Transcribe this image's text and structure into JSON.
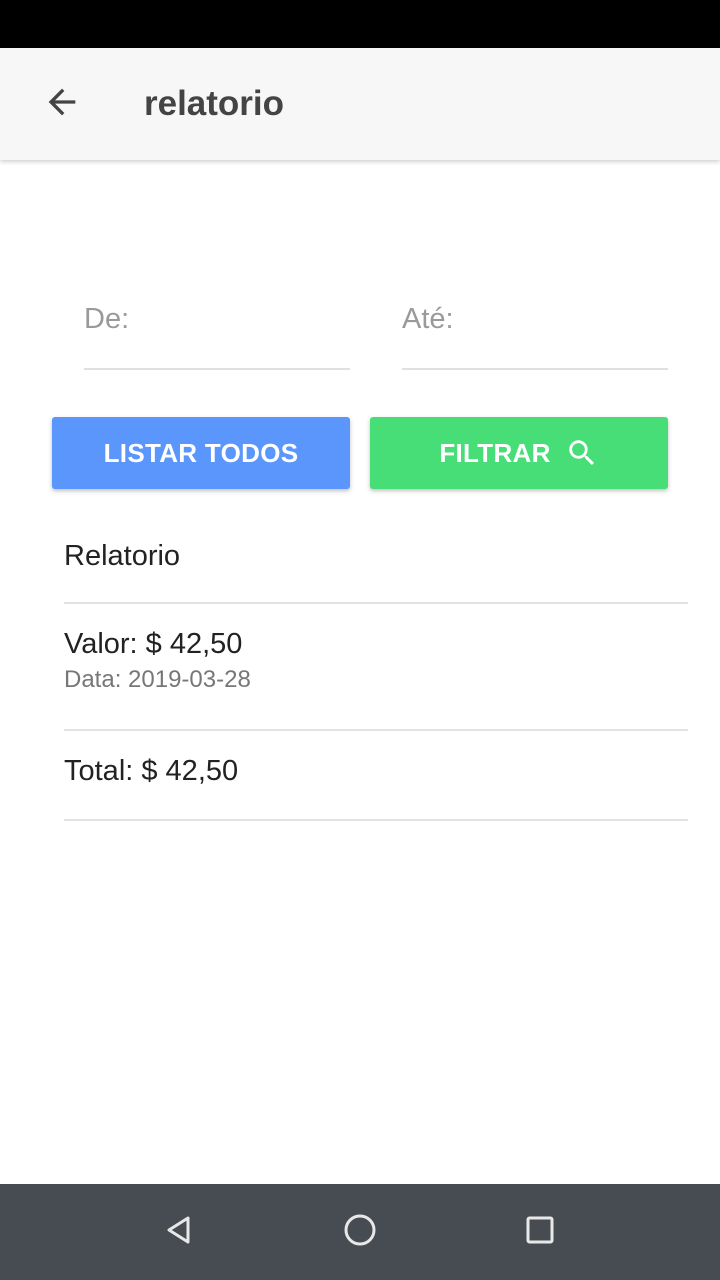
{
  "app_bar": {
    "title": "relatorio",
    "back_icon": "arrow-back-icon"
  },
  "filters": {
    "from_placeholder": "De:",
    "to_placeholder": "Até:",
    "from_value": "",
    "to_value": ""
  },
  "buttons": {
    "list_all_label": "LISTAR TODOS",
    "filter_label": "FILTRAR",
    "filter_icon": "search-icon",
    "list_all_color": "#5b96fc",
    "filter_color": "#47dd77"
  },
  "report": {
    "header": "Relatorio",
    "items": [
      {
        "value": "Valor: $ 42,50",
        "date": "Data: 2019-03-28"
      }
    ],
    "total": "Total: $ 42,50"
  },
  "nav_bar": {
    "back_icon": "triangle-back-icon",
    "home_icon": "circle-home-icon",
    "recents_icon": "square-recents-icon"
  }
}
